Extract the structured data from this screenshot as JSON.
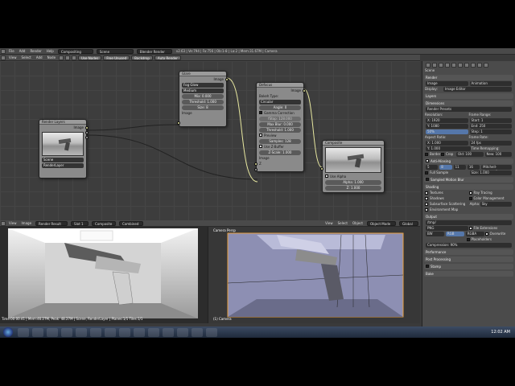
{
  "top_bar": {
    "menus": [
      "File",
      "Add",
      "Render",
      "Help"
    ],
    "editor_type": "Compositing",
    "scene": "Scene",
    "engine": "Blender Render",
    "stats": "v2.63 | Ve:794 | Fa:756 | Ob:1-8 | La:2 | Mem:31.67M | Camera"
  },
  "node_editor": {
    "nodes": {
      "render_layers": {
        "title": "Render Layers",
        "outputs": [
          "Image",
          "Alpha",
          "Z"
        ],
        "scene": "Scene",
        "layer": "RenderLayer"
      },
      "glare": {
        "title": "Glare",
        "outputs": [
          "Image"
        ],
        "type": "Fog Glow",
        "quality": "Medium",
        "mix": "Mix: 0.000",
        "threshold": "Threshold: 1.000",
        "size": "Size: 8",
        "input": "Image"
      },
      "defocus": {
        "title": "Defocus",
        "outputs": [
          "Image"
        ],
        "bokeh_label": "Bokeh Type:",
        "bokeh": "Circular",
        "angle": "Angle: 0",
        "gamma": "Gamma Correction",
        "fstop": "fStop: 128.000",
        "maxblur": "Max Blur: 0.000",
        "threshold": "Threshold: 1.000",
        "preview": "Preview",
        "samples": "Samples: 128",
        "use_zbuffer": "Use Z-Buffer",
        "zscale": "Z-Scale: 1.000",
        "inputs": [
          "Image",
          "Z"
        ]
      },
      "composite": {
        "title": "Composite",
        "use_alpha": "Use Alpha",
        "inputs": [
          "Image",
          "Alpha: 1.000",
          "Z: 1.000"
        ]
      }
    },
    "header": {
      "menus": [
        "View",
        "Select",
        "Add",
        "Node"
      ],
      "toggles": [
        "Use Nodes",
        "Free Unused",
        "Backdrop",
        "Auto Render"
      ]
    }
  },
  "properties": {
    "header_tabs": [
      "render",
      "layers",
      "scene",
      "world",
      "object",
      "constraints",
      "modifiers",
      "data",
      "material",
      "texture"
    ],
    "breadcrumb": "Scene",
    "sections": {
      "render": "Render",
      "image_btn": "Image",
      "anim_btn": "Animation",
      "display_label": "Display:",
      "display_val": "Image Editor",
      "layers": "Layers",
      "dimensions": "Dimensions",
      "preset": "Render Presets",
      "resolution": "Resolution:",
      "res_x": "X: 1920",
      "res_y": "Y: 1080",
      "res_pct": "50%",
      "frame_range": "Frame Range:",
      "start": "Start: 1",
      "end": "End: 250",
      "step": "Step: 1",
      "aspect": "Aspect Ratio:",
      "asp_x": "X: 1.000",
      "asp_y": "Y: 1.000",
      "frame_rate": "Frame Rate:",
      "fps": "24 fps",
      "time_remap": "Time Remapping:",
      "border": "Border",
      "crop": "Crop",
      "remap_old": "Old: 100",
      "remap_new": "New: 100",
      "antialias": "Anti-Aliasing",
      "aa_values": [
        "5",
        "8",
        "11",
        "16"
      ],
      "aa_filter": "Mitchell-Netravali",
      "full_sample": "Full Sample",
      "aa_size": "Size: 1.000",
      "motion_blur": "Sampled Motion Blur",
      "shading": "Shading",
      "textures": "Textures",
      "ray_tracing": "Ray Tracing",
      "shadows": "Shadows",
      "color_mgmt": "Color Management",
      "sss": "Subsurface Scattering",
      "alpha_label": "Alpha:",
      "alpha_val": "Sky",
      "env_map": "Environment Map",
      "output": "Output",
      "output_path": "/tmp/",
      "file_format": "PNG",
      "bw": "BW",
      "rgb": "RGB",
      "rgba": "RGBA",
      "file_ext": "File Extensions",
      "overwrite": "Overwrite",
      "placeholders": "Placeholders",
      "compression": "Compression: 90%",
      "performance": "Performance",
      "post_processing": "Post Processing",
      "stamp": "Stamp",
      "bake": "Bake"
    }
  },
  "viewports": {
    "camera_label": "Camera Persp",
    "object_label": "(1) Camera",
    "left_header": [
      "View",
      "Image"
    ],
    "left_image": "Render Result",
    "left_slot": "Slot 1",
    "left_layer": "Composite",
    "left_pass": "Combined",
    "right_header": [
      "View",
      "Select",
      "Object"
    ],
    "right_mode": "Object Mode",
    "right_layer": "Global"
  },
  "status": {
    "metadata": "Time:00:00.41 | Mem:46.27M, Peak: 48.27M | Scene, RenderLayer | Planes:1/1 Tiles:1/1"
  },
  "taskbar": {
    "time": "12:02 AM"
  }
}
